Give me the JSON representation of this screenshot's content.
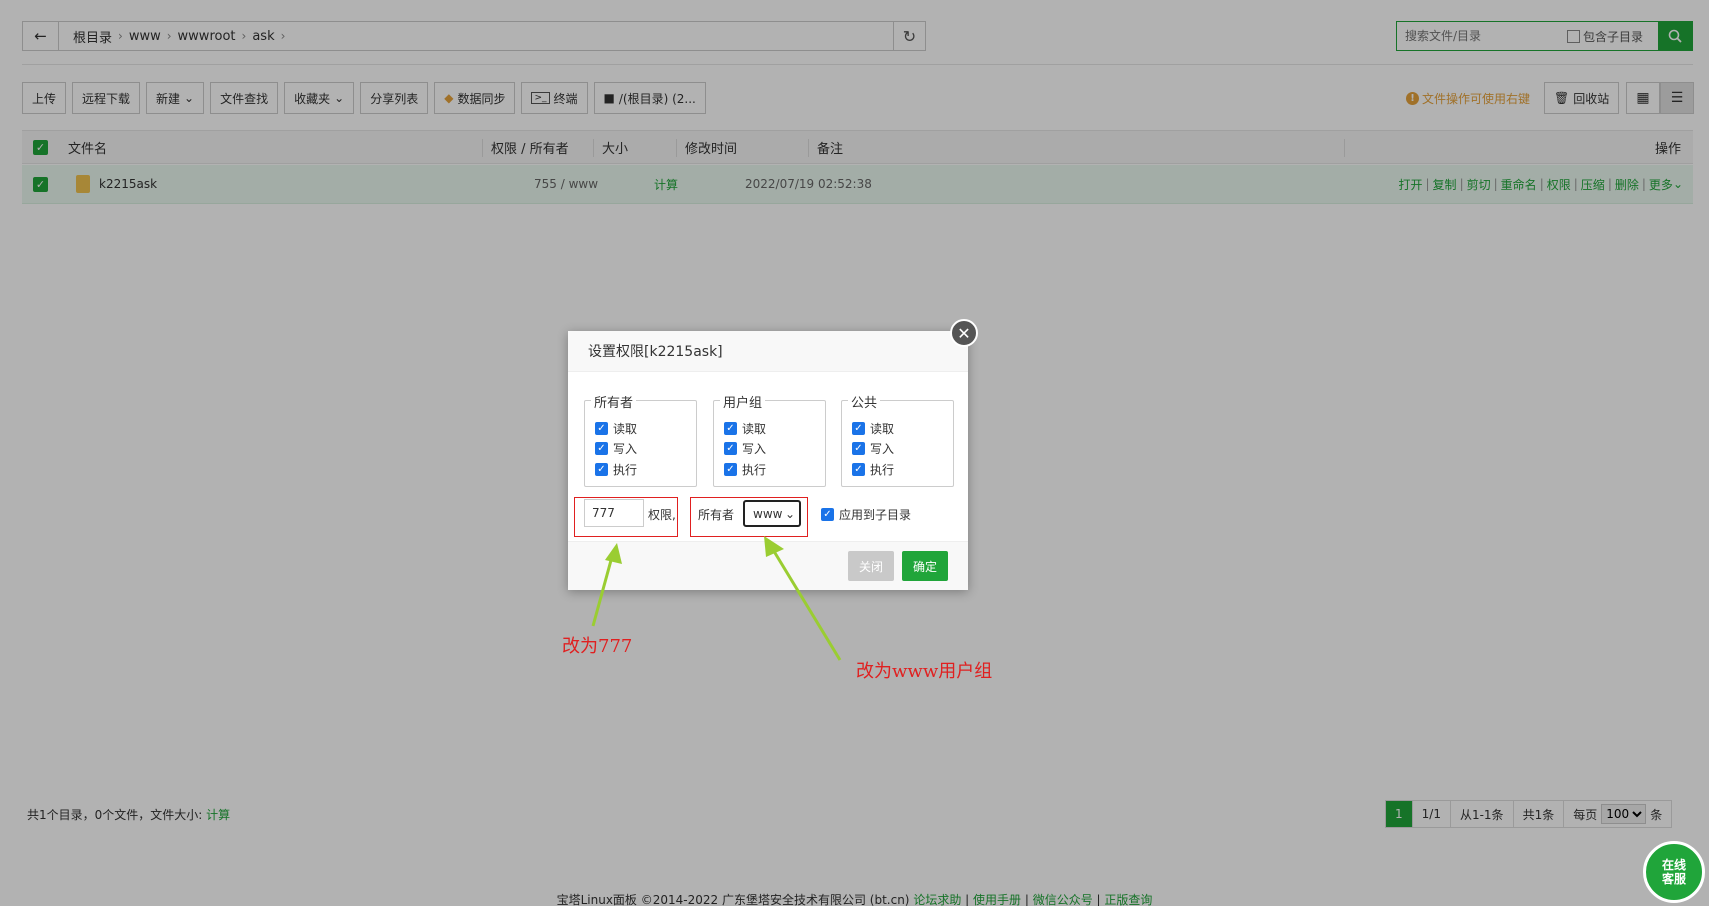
{
  "breadcrumb": [
    "根目录",
    "www",
    "wwwroot",
    "ask"
  ],
  "search": {
    "placeholder": "搜索文件/目录",
    "include_sub": "包含子目录"
  },
  "toolbar": {
    "upload": "上传",
    "remote_download": "远程下载",
    "new": "新建",
    "file_search": "文件查找",
    "favorites": "收藏夹",
    "share_list": "分享列表",
    "data_sync": "数据同步",
    "terminal": "终端",
    "disk": "/(根目录) (2..."
  },
  "tip": "文件操作可使用右键",
  "recycle": "回收站",
  "table": {
    "headers": {
      "name": "文件名",
      "perm": "权限 / 所有者",
      "size": "大小",
      "mtime": "修改时间",
      "note": "备注",
      "ops": "操作"
    },
    "rows": [
      {
        "name": "k2215ask",
        "perm": "755 / www",
        "size": "计算",
        "mtime": "2022/07/19 02:52:38",
        "note": ""
      }
    ],
    "row_ops": [
      "打开",
      "复制",
      "剪切",
      "重命名",
      "权限",
      "压缩",
      "删除",
      "更多"
    ]
  },
  "summary": {
    "text": "共1个目录，0个文件，文件大小:",
    "calc": "计算"
  },
  "pager": {
    "current": "1",
    "total_pages": "1/1",
    "range": "从1-1条",
    "count": "共1条",
    "per_page_label": "每页",
    "per_page": "100",
    "unit": "条"
  },
  "copyright": {
    "text": "宝塔Linux面板 ©2014-2022 广东堡塔安全技术有限公司 (bt.cn)",
    "links": [
      "论坛求助",
      "使用手册",
      "微信公众号",
      "正版查询"
    ]
  },
  "dialog": {
    "title": "设置权限[k2215ask]",
    "groups": [
      {
        "name": "所有者",
        "options": [
          "读取",
          "写入",
          "执行"
        ]
      },
      {
        "name": "用户组",
        "options": [
          "读取",
          "写入",
          "执行"
        ]
      },
      {
        "name": "公共",
        "options": [
          "读取",
          "写入",
          "执行"
        ]
      }
    ],
    "perm_value": "777",
    "perm_label": "权限,",
    "owner_label": "所有者",
    "owner_value": "www",
    "apply_sub": "应用到子目录",
    "close_btn": "关闭",
    "ok_btn": "确定"
  },
  "annotations": {
    "perm_note": "改为777",
    "owner_note": "改为www用户组"
  },
  "kefu": [
    "在线",
    "客服"
  ],
  "colors": {
    "accent": "#20a53a",
    "annotation": "#e02020",
    "tip": "#e6a23c"
  }
}
